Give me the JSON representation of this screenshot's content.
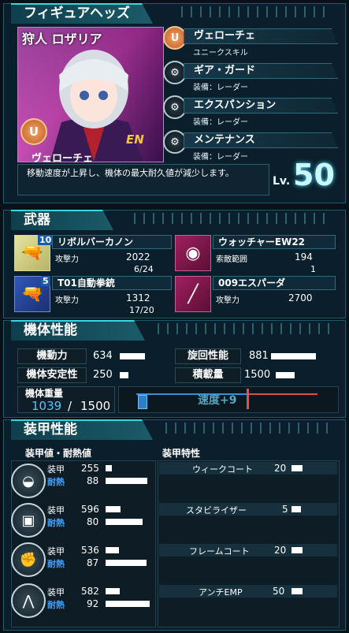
{
  "figure_heads": {
    "title": "フィギュアヘッズ",
    "pilot_name": "狩人 ロザリア",
    "pilot_skill": "ヴェローチェ",
    "en_badge": "EN",
    "description": "移動速度が上昇し、機体の最大耐久値が減少します。",
    "level_prefix": "Lv.",
    "level": "50",
    "skills": [
      {
        "icon": "U",
        "name": "ヴェローチェ",
        "sub": "ユニークスキル"
      },
      {
        "icon": "gear-icon",
        "name": "ギア・ガード",
        "sub": "装備：レーダー"
      },
      {
        "icon": "gear-icon",
        "name": "エクスパンション",
        "sub": "装備：レーダー"
      },
      {
        "icon": "gear-icon",
        "name": "メンテナンス",
        "sub": "装備：レーダー"
      }
    ]
  },
  "weapons": {
    "title": "武器",
    "items": [
      {
        "level": "10",
        "name": "リボルバーカノン",
        "stat_label": "攻撃力",
        "stat_value": "2022",
        "ammo": "6/24"
      },
      {
        "level": "",
        "name": "ウォッチャーEW22",
        "stat_label": "索敵範囲",
        "stat_value": "194",
        "ammo": "1"
      },
      {
        "level": "5",
        "name": "T01自動拳銃",
        "stat_label": "攻撃力",
        "stat_value": "1312",
        "ammo": "17/20"
      },
      {
        "level": "",
        "name": "009エスパーダ",
        "stat_label": "攻撃力",
        "stat_value": "2700",
        "ammo": ""
      }
    ]
  },
  "performance": {
    "title": "機体性能",
    "stats": [
      {
        "label": "機動力",
        "value": "634",
        "level": 0.45
      },
      {
        "label": "旋回性能",
        "value": "881",
        "level": 0.6
      },
      {
        "label": "機体安定性",
        "value": "250",
        "level": 0.12
      },
      {
        "label": "積載量",
        "value": "1500",
        "level": 0.25
      }
    ],
    "weight_label": "機体重量",
    "weight_current": "1039",
    "weight_sep": "/",
    "weight_max": "1500",
    "speed_text": "速度+9"
  },
  "armor": {
    "title": "装甲性能",
    "col_left": "装甲値・耐熱値",
    "col_right": "装甲特性",
    "armor_label": "装甲",
    "heat_label": "耐熱",
    "rows": [
      {
        "part": "head-icon",
        "armor": "255",
        "armor_level": 0.08,
        "heat": "88",
        "heat_level": 0.7,
        "trait": "ウィークコート",
        "trait_value": "20"
      },
      {
        "part": "body-icon",
        "armor": "596",
        "armor_level": 0.35,
        "heat": "80",
        "heat_level": 0.62,
        "trait": "スタビライザー",
        "trait_value": "5"
      },
      {
        "part": "arm-icon",
        "armor": "536",
        "armor_level": 0.3,
        "heat": "87",
        "heat_level": 0.69,
        "trait": "フレームコート",
        "trait_value": "20"
      },
      {
        "part": "leg-icon",
        "armor": "582",
        "armor_level": 0.33,
        "heat": "92",
        "heat_level": 0.74,
        "trait": "アンチEMP",
        "trait_value": "50"
      }
    ]
  }
}
